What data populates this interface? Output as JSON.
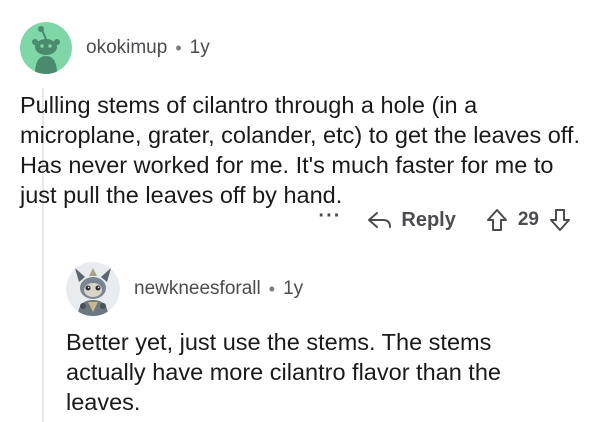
{
  "comment": {
    "username": "okokimup",
    "separator": "•",
    "age": "1y",
    "body": "Pulling stems of cilantro through a hole (in a microplane, grater, colander, etc) to get the leaves off. Has never worked for me. It's much faster for me to just pull the leaves off by hand.",
    "more_label": "···",
    "reply_label": "Reply",
    "score": "29"
  },
  "reply": {
    "username": "newkneesforall",
    "separator": "•",
    "age": "1y",
    "body": "Better yet, just use the stems. The stems actually have more cilantro flavor than the leaves."
  },
  "colors": {
    "avatar1_bg": "#7fd6a6",
    "snoo_fill": "#4a8a6d",
    "text": "#1a1a1b",
    "meta": "#4a4c4f"
  }
}
